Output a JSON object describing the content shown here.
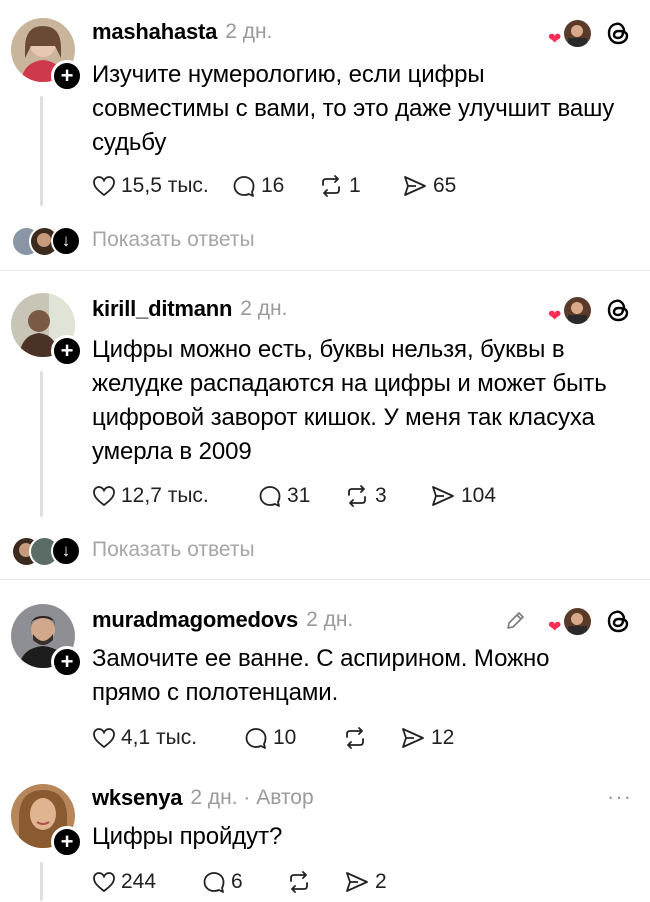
{
  "posts": [
    {
      "username": "mashahasta",
      "time": "2 дн.",
      "text": "Изучите нумерологию, если цифры совместимы с вами, то это даже улучшит вашу судьбу",
      "likes": "15,5 тыс.",
      "comments": "16",
      "reposts": "1",
      "shares": "65",
      "show_replies": "Показать ответы"
    },
    {
      "username": "kirill_ditmann",
      "time": "2 дн.",
      "text": "Цифры можно есть, буквы нельзя, буквы в желудке распадаются на цифры и может быть цифровой заворот кишок. У меня так класуха умерла в 2009",
      "likes": "12,7 тыс.",
      "comments": "31",
      "reposts": "3",
      "shares": "104",
      "show_replies": "Показать ответы"
    },
    {
      "username": "muradmagomedovs",
      "time": "2 дн.",
      "text": "Замочите ее ванне. С аспирином. Можно прямо с полотенцами.",
      "likes": "4,1 тыс.",
      "comments": "10",
      "reposts": "",
      "shares": "12"
    },
    {
      "username": "wksenya",
      "time": "2 дн. · Автор",
      "text": "Цифры пройдут?",
      "likes": "244",
      "comments": "6",
      "reposts": "",
      "shares": "2",
      "more": "···"
    }
  ],
  "icons": {
    "like": "heart-icon",
    "comment": "comment-icon",
    "repost": "repost-icon",
    "share": "share-icon",
    "threads": "threads-logo-icon",
    "edit": "pencil-icon",
    "follow": "plus-icon",
    "expand": "arrow-down-icon"
  },
  "colors": {
    "heart": "#ff2d55",
    "muted": "#9a9a9a",
    "divider": "#e6e6e6"
  }
}
